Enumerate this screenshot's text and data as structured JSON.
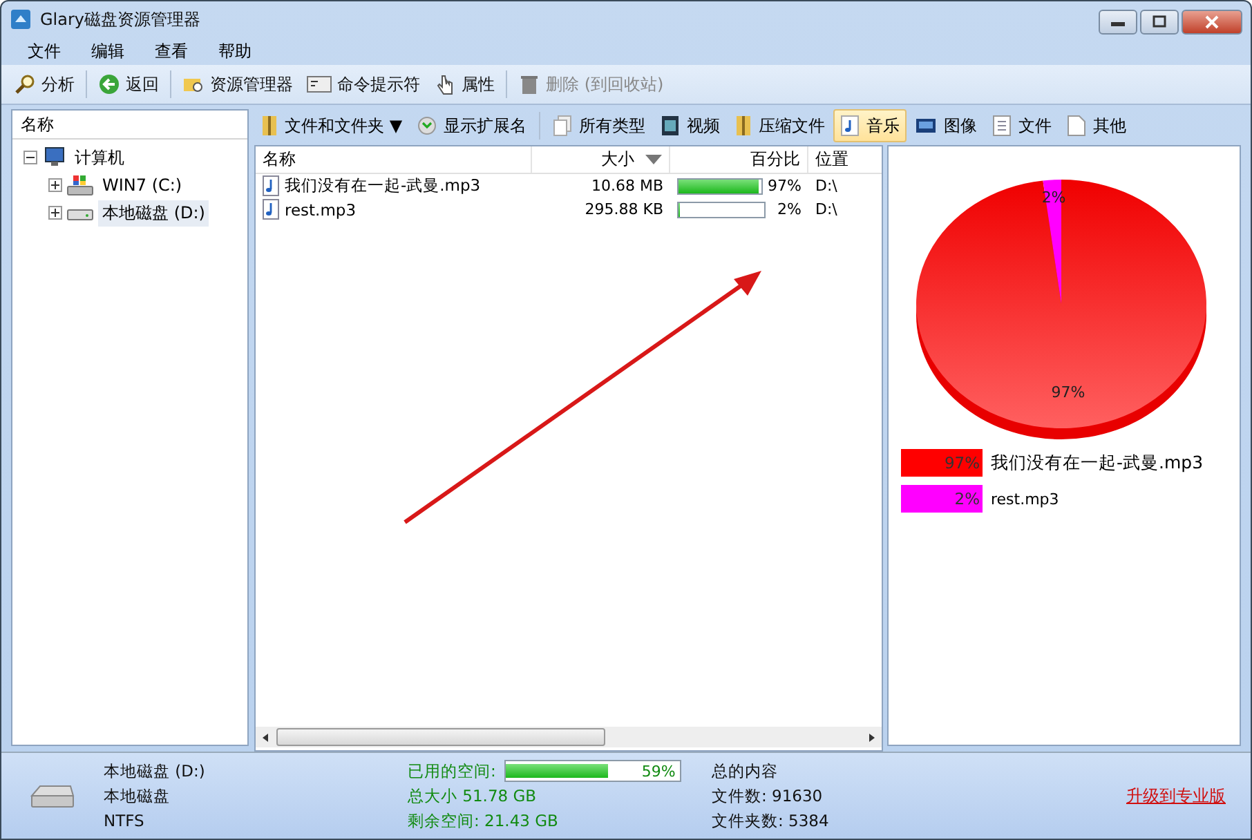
{
  "window": {
    "title": "Glary磁盘资源管理器"
  },
  "menu": [
    "文件",
    "编辑",
    "查看",
    "帮助"
  ],
  "toolbar": [
    {
      "label": "分析",
      "disabled": false
    },
    {
      "label": "返回",
      "disabled": false
    },
    {
      "label": "资源管理器",
      "disabled": false
    },
    {
      "label": "命令提示符",
      "disabled": false
    },
    {
      "label": "属性",
      "disabled": false
    },
    {
      "label": "删除 (到回收站)",
      "disabled": true
    }
  ],
  "tree": {
    "header": "名称",
    "items": [
      {
        "label": "计算机",
        "expanded": true,
        "selected": false,
        "children": [
          {
            "label": "WIN7 (C:)",
            "expanded": false,
            "selected": false
          },
          {
            "label": "本地磁盘 (D:)",
            "expanded": false,
            "selected": true
          }
        ]
      }
    ]
  },
  "view_options": [
    {
      "label": "文件和文件夹 ▼"
    },
    {
      "label": "显示扩展名"
    }
  ],
  "filters": [
    {
      "label": "所有类型",
      "selected": false
    },
    {
      "label": "视频",
      "selected": false
    },
    {
      "label": "压缩文件",
      "selected": false
    },
    {
      "label": "音乐",
      "selected": true
    },
    {
      "label": "图像",
      "selected": false
    },
    {
      "label": "文件",
      "selected": false
    },
    {
      "label": "其他",
      "selected": false
    }
  ],
  "file_list": {
    "columns": [
      {
        "label": "名称",
        "sorted": false
      },
      {
        "label": "大小",
        "sorted": true
      },
      {
        "label": "百分比",
        "sorted": false
      },
      {
        "label": "位置",
        "sorted": false
      }
    ],
    "rows": [
      {
        "name": "我们没有在一起-武曼.mp3",
        "size": "10.68 MB",
        "level": 0.97,
        "percent": "97%",
        "location": "D:\\"
      },
      {
        "name": "rest.mp3",
        "size": "295.88 KB",
        "level": 0.02,
        "percent": "2%",
        "location": "D:\\"
      }
    ]
  },
  "chart": {
    "chart_data": {
      "type": "pie",
      "categories": [
        "我们没有在一起-武曼.mp3",
        "rest.mp3"
      ],
      "values": [
        97,
        2
      ],
      "data_labels": true,
      "value_labels": [
        "97%",
        "2%"
      ]
    },
    "legend": [
      {
        "percent": "97%",
        "color": "#ff0000"
      },
      {
        "percent": "2%",
        "color": "#ff00ff"
      }
    ]
  },
  "status_bar": {
    "drive_name": "本地磁盘 (D:)",
    "drive_label": "本地磁盘",
    "file_system": "NTFS",
    "used_label": "已用的空间:",
    "used": {
      "level": 0.59,
      "reading": "59%"
    },
    "total": "总大小 51.78 GB",
    "free": "剩余空间: 21.43 GB",
    "content_title": "总的内容",
    "file_count": "文件数: 91630",
    "folder_count": "文件夹数: 5384",
    "upgrade_link": "升级到专业版"
  }
}
